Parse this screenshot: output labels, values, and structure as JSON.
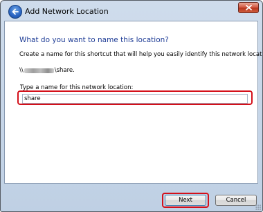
{
  "window": {
    "title": "Add Network Location",
    "accent_color": "#1e3c96",
    "highlight_color": "#d4101a"
  },
  "titlebar": {
    "close_icon": "close-icon"
  },
  "nav": {
    "back_icon": "back-arrow-icon"
  },
  "main": {
    "heading": "What do you want to name this location?",
    "description": "Create a name for this shortcut that will help you easily identify this network location:",
    "path_prefix": "\\\\",
    "path_suffix": "\\share.",
    "field_label": "Type a name for this network location:",
    "field_value": "share"
  },
  "footer": {
    "next_label": "Next",
    "cancel_label": "Cancel"
  }
}
